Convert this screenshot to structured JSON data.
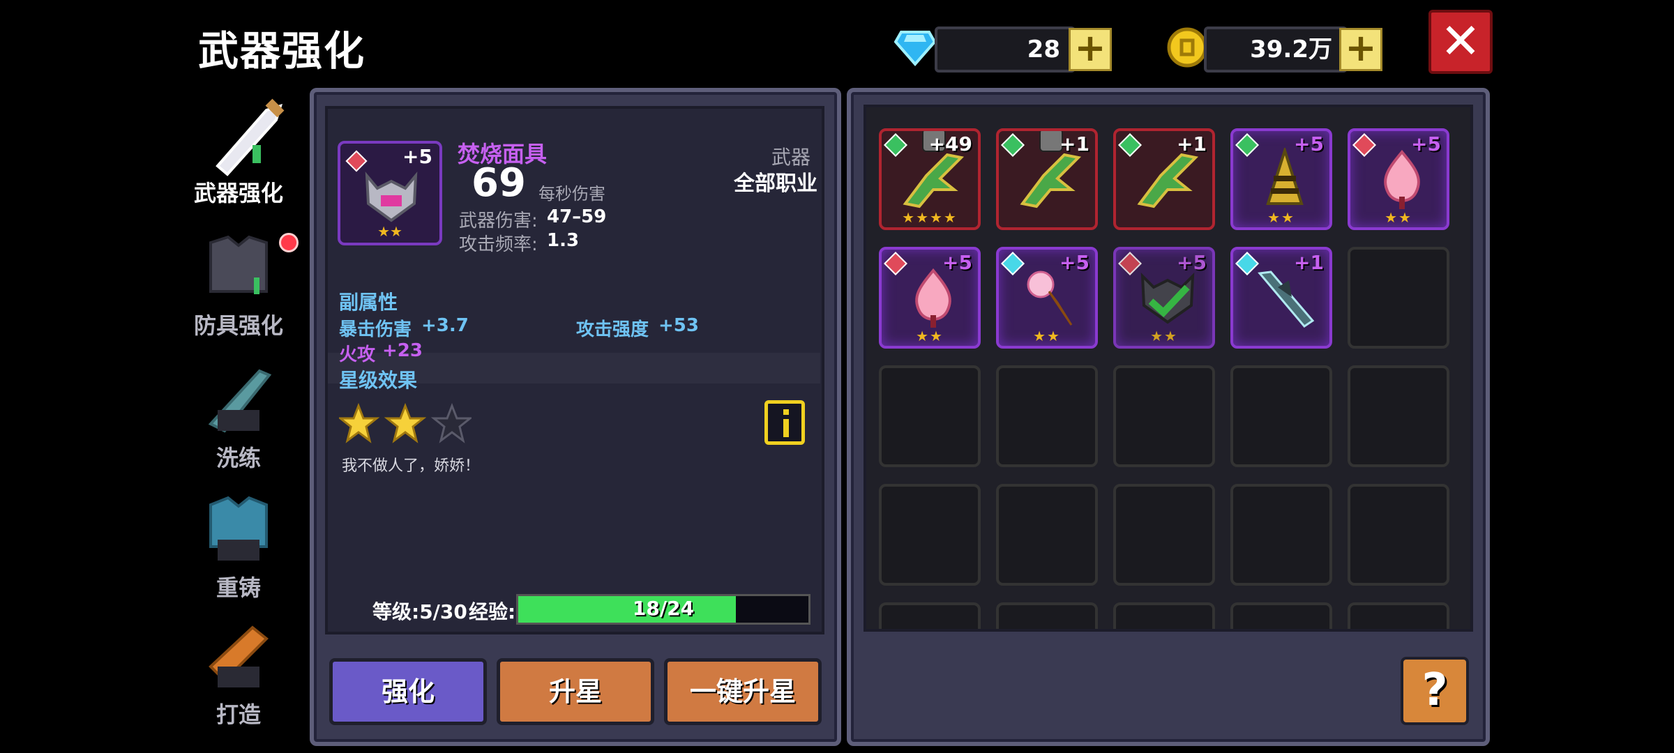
{
  "header": {
    "title": "武器强化",
    "gems": "28",
    "gold": "39.2万",
    "plus": "+",
    "close": "✕"
  },
  "sidebar": {
    "items": [
      {
        "label": "武器强化",
        "active": true
      },
      {
        "label": "防具强化"
      },
      {
        "label": "洗练"
      },
      {
        "label": "重铸"
      },
      {
        "label": "打造"
      }
    ]
  },
  "weapon": {
    "name": "焚烧面具",
    "level_badge": "+5",
    "dps": "69",
    "dps_label": "每秒伤害",
    "damage_label": "武器伤害:",
    "damage": "47–59",
    "rate_label": "攻击频率:",
    "rate": "1.3",
    "type": "武器",
    "class": "全部职业"
  },
  "sub_attr": {
    "title": "副属性",
    "items": [
      {
        "label": "暴击伤害",
        "value": "+3.7"
      },
      {
        "label": "攻击强度",
        "value": "+53"
      },
      {
        "label": "火攻",
        "value": "+23"
      }
    ]
  },
  "star_effect": {
    "title": "星级效果",
    "stars_filled": 2,
    "stars_total": 3,
    "quote": "我不做人了，娇娇！"
  },
  "progress": {
    "level_text": "等级:5/30",
    "exp_label": "经验:",
    "exp_text": "18/24",
    "exp_fraction": 0.75
  },
  "buttons": {
    "enhance": "强化",
    "star_up": "升星",
    "one_key": "一键升星",
    "help": "?"
  },
  "inventory": [
    {
      "level": "+49",
      "rarity": "red",
      "icon": "green-dragon-icon",
      "locked": true,
      "stars": "★★★★",
      "gem": "#3ac060"
    },
    {
      "level": "+1",
      "rarity": "red",
      "icon": "green-dragon-icon",
      "locked": true,
      "stars": "",
      "gem": "#3ac060"
    },
    {
      "level": "+1",
      "rarity": "red",
      "icon": "green-dragon-icon",
      "locked": false,
      "stars": "",
      "gem": "#3ac060"
    },
    {
      "level": "+5",
      "rarity": "purple",
      "icon": "gold-drill-icon",
      "locked": false,
      "stars": "★★",
      "gem": "#3ac060"
    },
    {
      "level": "+5",
      "rarity": "purple",
      "icon": "pink-flame-icon",
      "locked": false,
      "stars": "★★",
      "gem": "#e04a5a"
    },
    {
      "level": "+5",
      "rarity": "purple",
      "icon": "pink-flame-icon",
      "locked": false,
      "stars": "★★",
      "gem": "#e04a5a"
    },
    {
      "level": "+5",
      "rarity": "purple",
      "icon": "ice-cream-icon",
      "locked": false,
      "stars": "★★",
      "gem": "#48d8e8"
    },
    {
      "level": "+5",
      "rarity": "purple",
      "icon": "mask-selected-icon",
      "locked": false,
      "stars": "★★",
      "gem": "#e04a5a",
      "selected": true
    },
    {
      "level": "+1",
      "rarity": "purple",
      "icon": "dark-spear-icon",
      "locked": false,
      "stars": "",
      "gem": "#48d8e8"
    }
  ]
}
